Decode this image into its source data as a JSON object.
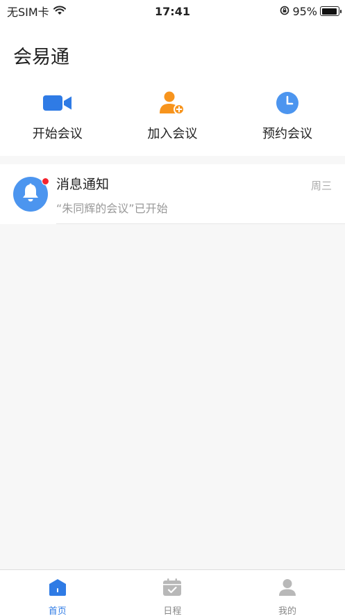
{
  "status_bar": {
    "carrier": "无SIM卡",
    "time": "17:41",
    "battery_percent": "95%",
    "battery_level": 0.95
  },
  "header": {
    "title": "会易通"
  },
  "quick_actions": [
    {
      "label": "开始会议",
      "icon": "video-camera-icon",
      "color": "#2f7be5"
    },
    {
      "label": "加入会议",
      "icon": "add-user-icon",
      "color": "#f7941d"
    },
    {
      "label": "预约会议",
      "icon": "clock-icon",
      "color": "#4c95ef"
    }
  ],
  "messages": [
    {
      "title": "消息通知",
      "subtitle": "“朱同辉的会议”已开始",
      "time": "周三",
      "unread": true
    }
  ],
  "tab_bar": [
    {
      "label": "首页",
      "icon": "home-icon",
      "active": true
    },
    {
      "label": "日程",
      "icon": "calendar-icon",
      "active": false
    },
    {
      "label": "我的",
      "icon": "profile-icon",
      "active": false
    }
  ],
  "colors": {
    "accent": "#2f7be5",
    "orange": "#f7941d",
    "light_blue": "#4c95ef",
    "unread_dot": "#f5222d"
  }
}
